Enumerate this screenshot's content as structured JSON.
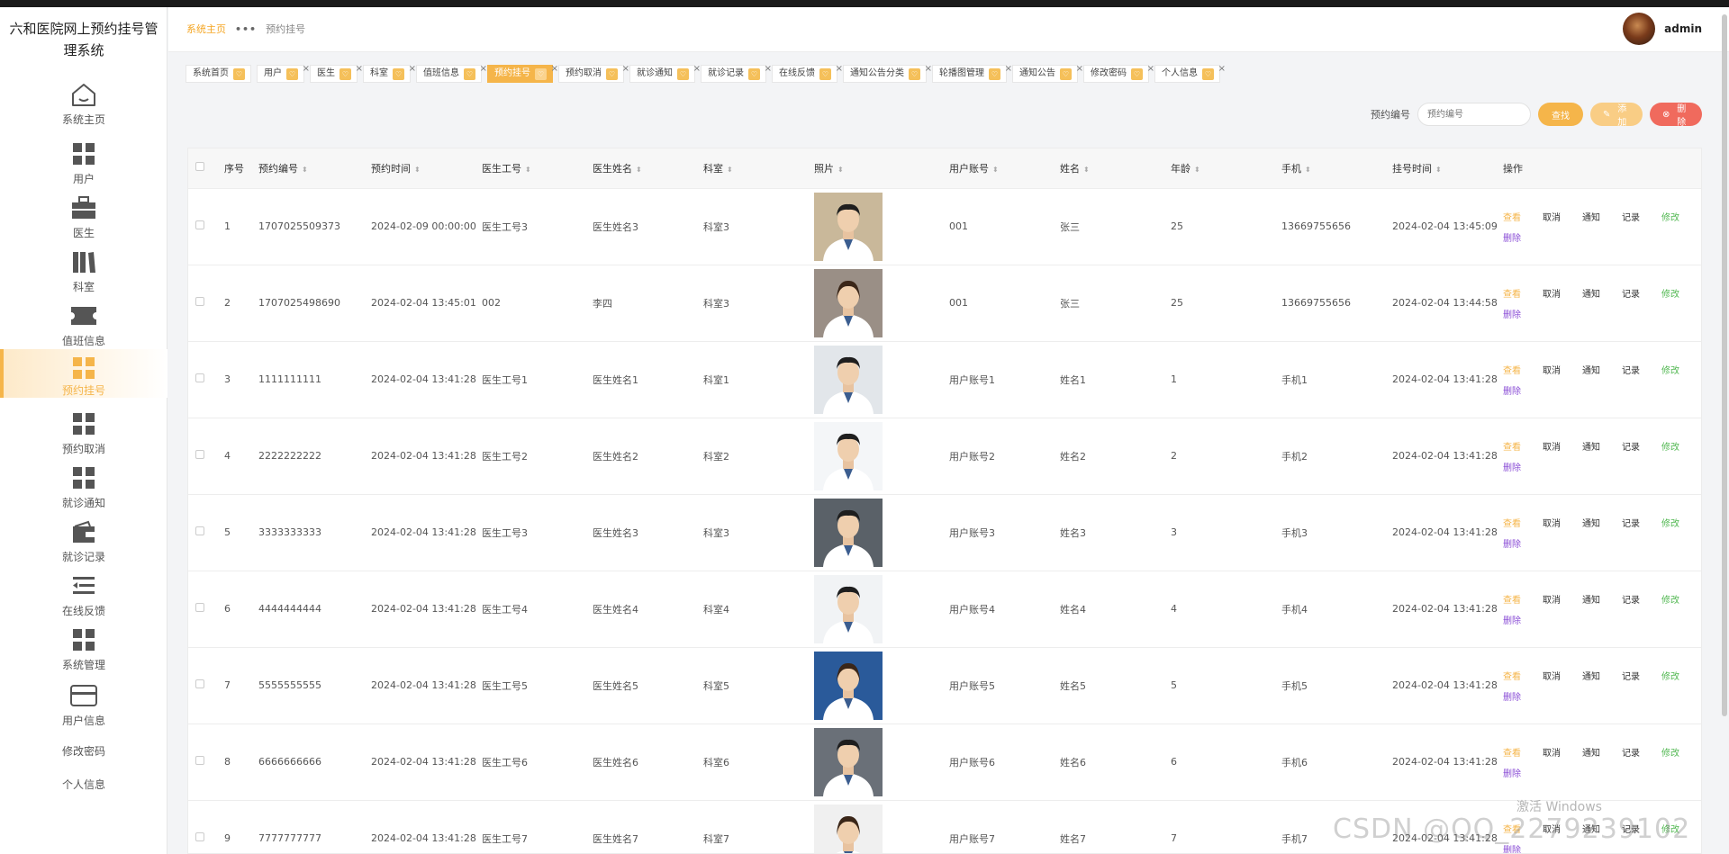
{
  "app": {
    "title": "六和医院网上预约挂号管理系统"
  },
  "sidebar": {
    "items": [
      {
        "label": "系统主页",
        "icon": "home-icon"
      },
      {
        "label": "用户",
        "icon": "grid-icon"
      },
      {
        "label": "医生",
        "icon": "briefcase-icon"
      },
      {
        "label": "科室",
        "icon": "books-icon"
      },
      {
        "label": "值班信息",
        "icon": "ticket-icon"
      },
      {
        "label": "预约挂号",
        "icon": "grid-icon",
        "active": true
      },
      {
        "label": "预约取消",
        "icon": "grid-icon"
      },
      {
        "label": "就诊通知",
        "icon": "grid-icon"
      },
      {
        "label": "就诊记录",
        "icon": "wallet-icon"
      },
      {
        "label": "在线反馈",
        "icon": "list-icon"
      },
      {
        "label": "系统管理",
        "icon": "grid-icon"
      },
      {
        "label": "用户信息",
        "icon": "card-icon"
      },
      {
        "label": "修改密码"
      },
      {
        "label": "个人信息"
      }
    ]
  },
  "header": {
    "breadcrumb": {
      "home": "系统主页",
      "current": "预约挂号"
    },
    "user": "admin"
  },
  "tabs": [
    "系统首页",
    "用户",
    "医生",
    "科室",
    "值班信息",
    "预约挂号",
    "预约取消",
    "就诊通知",
    "就诊记录",
    "在线反馈",
    "通知公告分类",
    "轮播图管理",
    "通知公告",
    "修改密码",
    "个人信息"
  ],
  "active_tab_index": 5,
  "search": {
    "label": "预约编号",
    "placeholder": "预约编号",
    "find": "查找",
    "add": "添加",
    "delete": "删除"
  },
  "table": {
    "headers": [
      "序号",
      "预约编号",
      "预约时间",
      "医生工号",
      "医生姓名",
      "科室",
      "照片",
      "用户账号",
      "姓名",
      "年龄",
      "手机",
      "挂号时间",
      "操作"
    ],
    "ops": {
      "view": "查看",
      "cancel": "取消",
      "notify": "通知",
      "record": "记录",
      "edit": "修改",
      "delete": "删除"
    },
    "rows": [
      {
        "idx": "1",
        "no": "1707025509373",
        "time": "2024-02-09 00:00:00",
        "doc_id": "医生工号3",
        "doc_name": "医生姓名3",
        "dept": "科室3",
        "account": "001",
        "name": "张三",
        "age": "25",
        "phone": "13669755656",
        "reg_time": "2024-02-04 13:45:09",
        "photo": "male"
      },
      {
        "idx": "2",
        "no": "1707025498690",
        "time": "2024-02-04 13:45:01",
        "doc_id": "002",
        "doc_name": "李四",
        "dept": "科室3",
        "account": "001",
        "name": "张三",
        "age": "25",
        "phone": "13669755656",
        "reg_time": "2024-02-04 13:44:58",
        "photo": "female"
      },
      {
        "idx": "3",
        "no": "1111111111",
        "time": "2024-02-04 13:41:28",
        "doc_id": "医生工号1",
        "doc_name": "医生姓名1",
        "dept": "科室1",
        "account": "用户账号1",
        "name": "姓名1",
        "age": "1",
        "phone": "手机1",
        "reg_time": "2024-02-04 13:41:28",
        "photo": "male"
      },
      {
        "idx": "4",
        "no": "2222222222",
        "time": "2024-02-04 13:41:28",
        "doc_id": "医生工号2",
        "doc_name": "医生姓名2",
        "dept": "科室2",
        "account": "用户账号2",
        "name": "姓名2",
        "age": "2",
        "phone": "手机2",
        "reg_time": "2024-02-04 13:41:28",
        "photo": "male"
      },
      {
        "idx": "5",
        "no": "3333333333",
        "time": "2024-02-04 13:41:28",
        "doc_id": "医生工号3",
        "doc_name": "医生姓名3",
        "dept": "科室3",
        "account": "用户账号3",
        "name": "姓名3",
        "age": "3",
        "phone": "手机3",
        "reg_time": "2024-02-04 13:41:28",
        "photo": "male"
      },
      {
        "idx": "6",
        "no": "4444444444",
        "time": "2024-02-04 13:41:28",
        "doc_id": "医生工号4",
        "doc_name": "医生姓名4",
        "dept": "科室4",
        "account": "用户账号4",
        "name": "姓名4",
        "age": "4",
        "phone": "手机4",
        "reg_time": "2024-02-04 13:41:28",
        "photo": "male"
      },
      {
        "idx": "7",
        "no": "5555555555",
        "time": "2024-02-04 13:41:28",
        "doc_id": "医生工号5",
        "doc_name": "医生姓名5",
        "dept": "科室5",
        "account": "用户账号5",
        "name": "姓名5",
        "age": "5",
        "phone": "手机5",
        "reg_time": "2024-02-04 13:41:28",
        "photo": "female"
      },
      {
        "idx": "8",
        "no": "6666666666",
        "time": "2024-02-04 13:41:28",
        "doc_id": "医生工号6",
        "doc_name": "医生姓名6",
        "dept": "科室6",
        "account": "用户账号6",
        "name": "姓名6",
        "age": "6",
        "phone": "手机6",
        "reg_time": "2024-02-04 13:41:28",
        "photo": "male"
      },
      {
        "idx": "9",
        "no": "7777777777",
        "time": "2024-02-04 13:41:28",
        "doc_id": "医生工号7",
        "doc_name": "医生姓名7",
        "dept": "科室7",
        "account": "用户账号7",
        "name": "姓名7",
        "age": "7",
        "phone": "手机7",
        "reg_time": "2024-02-04 13:41:28",
        "photo": "female"
      }
    ]
  },
  "watermark": {
    "line1": "激活 Windows",
    "line2": "CSDN @QQ_2279239102"
  },
  "colors": {
    "accent": "#f5b54a",
    "danger": "#f06a5d",
    "edit": "#52b852",
    "delete_link": "#8a4dd6"
  }
}
